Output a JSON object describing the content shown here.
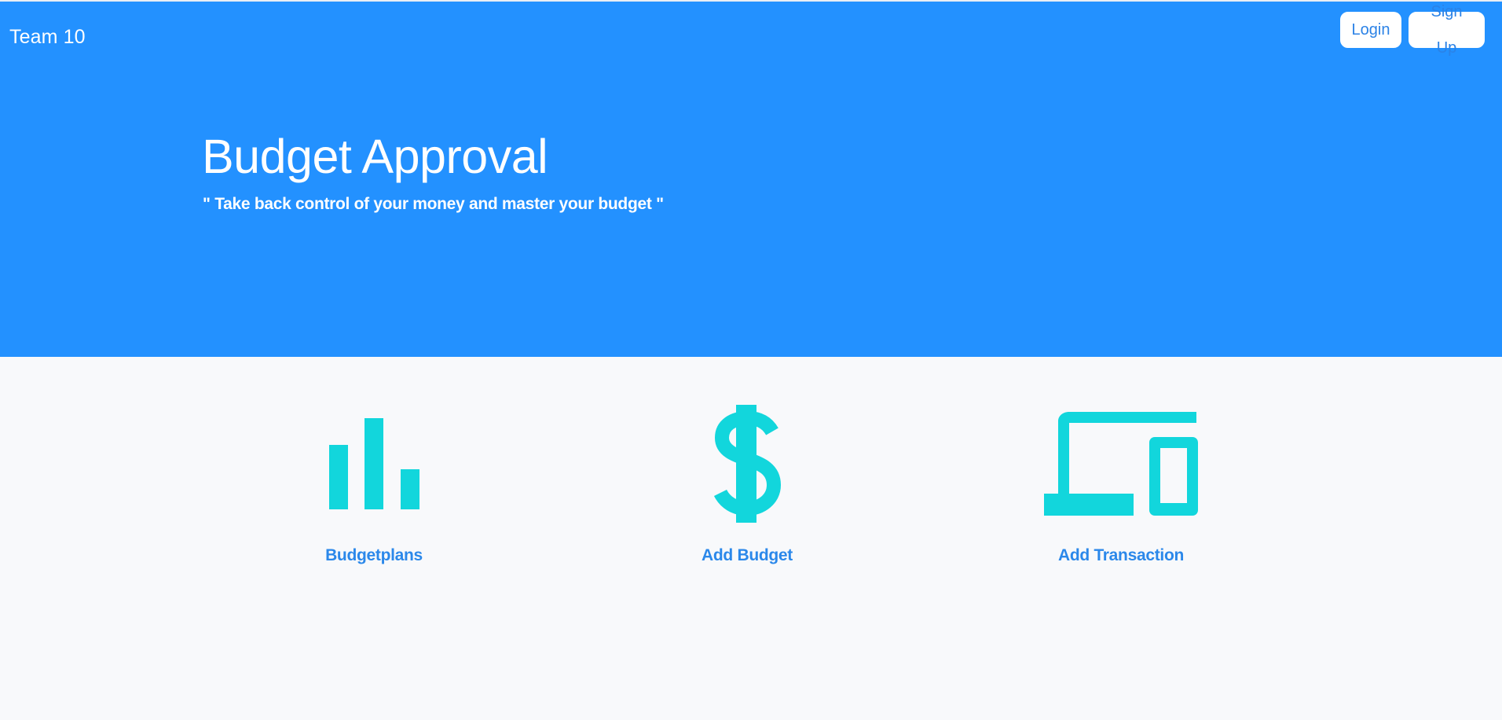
{
  "header": {
    "brand": "Team 10",
    "login_label": "Login",
    "signup_label": "Sign Up"
  },
  "hero": {
    "title": "Budget Approval",
    "subtitle": "\" Take back control of your money and master your budget \""
  },
  "features": [
    {
      "label": "Budgetplans",
      "icon": "bar-chart-icon"
    },
    {
      "label": "Add Budget",
      "icon": "dollar-icon"
    },
    {
      "label": "Add Transaction",
      "icon": "devices-icon"
    }
  ],
  "colors": {
    "hero_background": "#2391ff",
    "page_background": "#f8f9fb",
    "icon_accent": "#12d6dc",
    "link_blue": "#2b88ea",
    "button_background": "#ffffff"
  }
}
